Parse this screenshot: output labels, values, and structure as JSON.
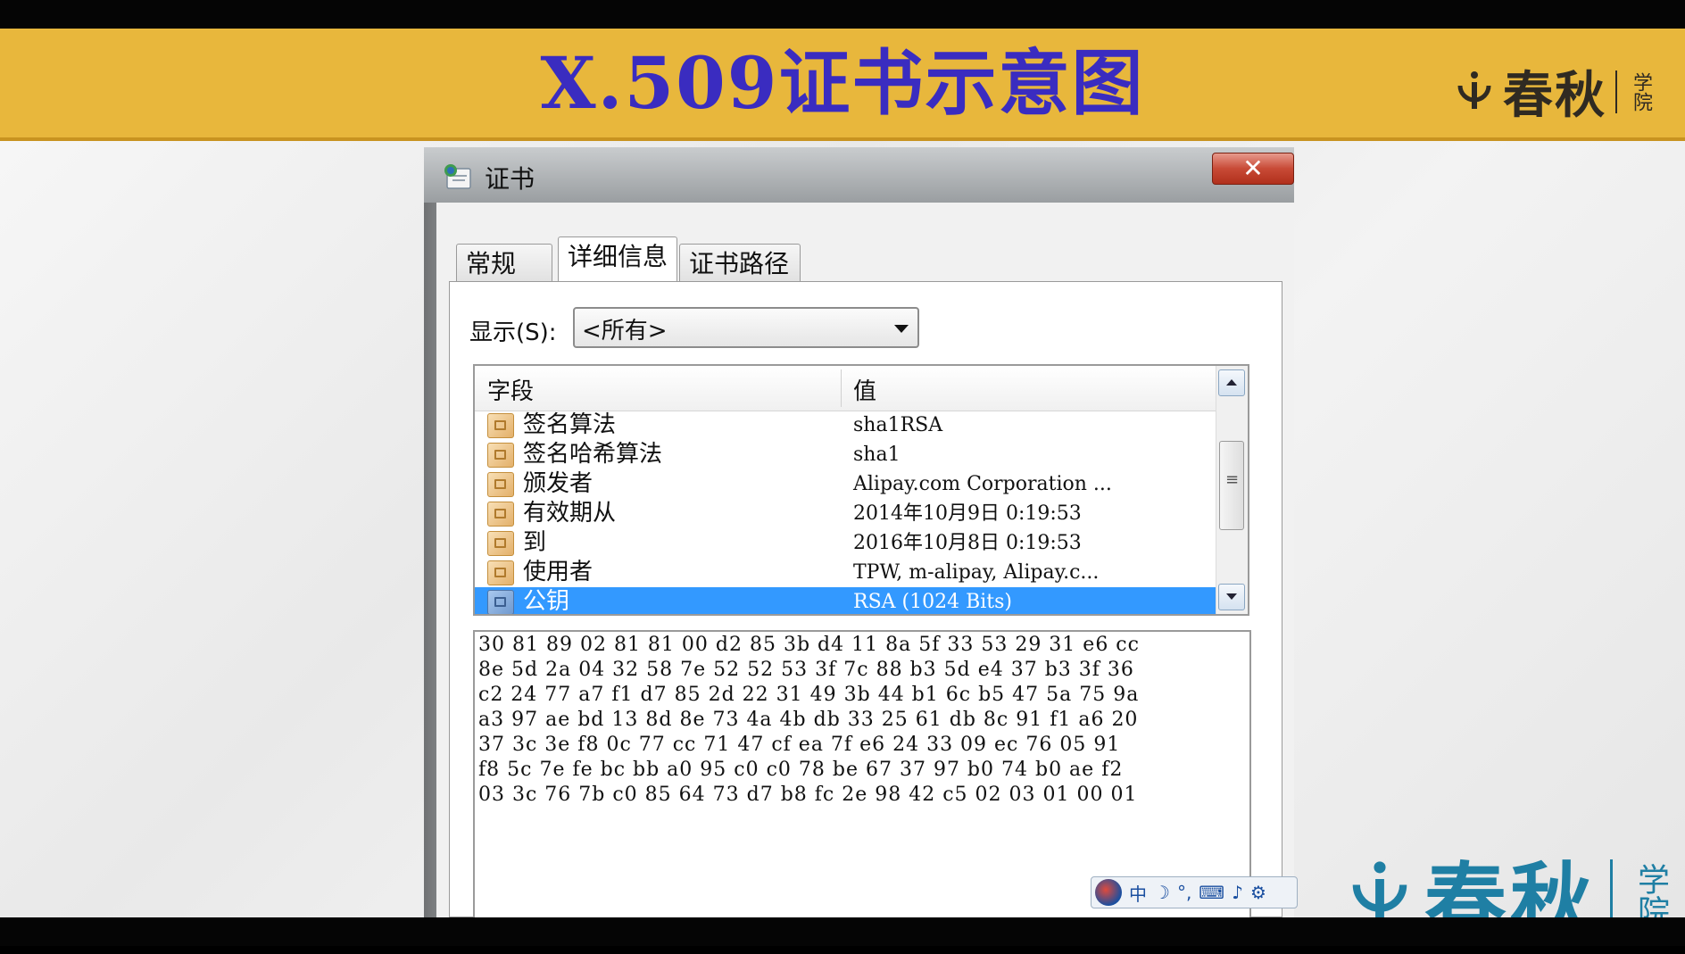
{
  "slide": {
    "title": "X.509证书示意图",
    "logo_top": {
      "brand": "春秋",
      "sub": "学院"
    },
    "logo_bottom": {
      "brand": "春秋",
      "sub": "学院"
    }
  },
  "window": {
    "title": "证书",
    "close_label": "✕",
    "tabs": [
      {
        "label": "常规",
        "active": false
      },
      {
        "label": "详细信息",
        "active": true
      },
      {
        "label": "证书路径",
        "active": false
      }
    ],
    "show_label": "显示(S):",
    "show_value": "<所有>",
    "columns": {
      "field": "字段",
      "value": "值"
    },
    "rows": [
      {
        "field": "签名算法",
        "value": "sha1RSA"
      },
      {
        "field": "签名哈希算法",
        "value": "sha1"
      },
      {
        "field": "颁发者",
        "value": "Alipay.com Corporation ..."
      },
      {
        "field": "有效期从",
        "value": "2014年10月9日 0:19:53"
      },
      {
        "field": "到",
        "value": "2016年10月8日 0:19:53"
      },
      {
        "field": "使用者",
        "value": "TPW, m-alipay, Alipay.c..."
      },
      {
        "field": "公钥",
        "value": "RSA (1024 Bits)",
        "selected": true
      }
    ],
    "hex_lines": [
      "30 81 89 02 81 81 00 d2 85 3b d4 11 8a 5f 33 53 29 31 e6 cc",
      "8e 5d 2a 04 32 58 7e 52 52 53 3f 7c 88 b3 5d e4 37 b3 3f 36",
      "c2 24 77 a7 f1 d7 85 2d 22 31 49 3b 44 b1 6c b5 47 5a 75 9a",
      "a3 97 ae bd 13 8d 8e 73 4a 4b db 33 25 61 db 8c 91 f1 a6 20",
      "37 3c 3e f8 0c 77 cc 71 47 cf ea 7f e6 24 33 09 ec 76 05 91",
      "f8 5c 7e fe bc bb a0 95 c0 c0 78 be 67 37 97 b0 74 b0 ae f2",
      "03 3c 76 7b c0 85 64 73 d7 b8 fc 2e 98 42 c5 02 03 01 00 01"
    ]
  },
  "ime": {
    "mode": "中",
    "items": [
      "moon-icon",
      "punctuation-icon",
      "keyboard-icon",
      "microphone-icon",
      "gear-icon"
    ]
  },
  "colors": {
    "header_bg": "#e8b73c",
    "title": "#3a2cc0",
    "selection": "#3399ff",
    "logo_blue": "#1f7fa4"
  }
}
